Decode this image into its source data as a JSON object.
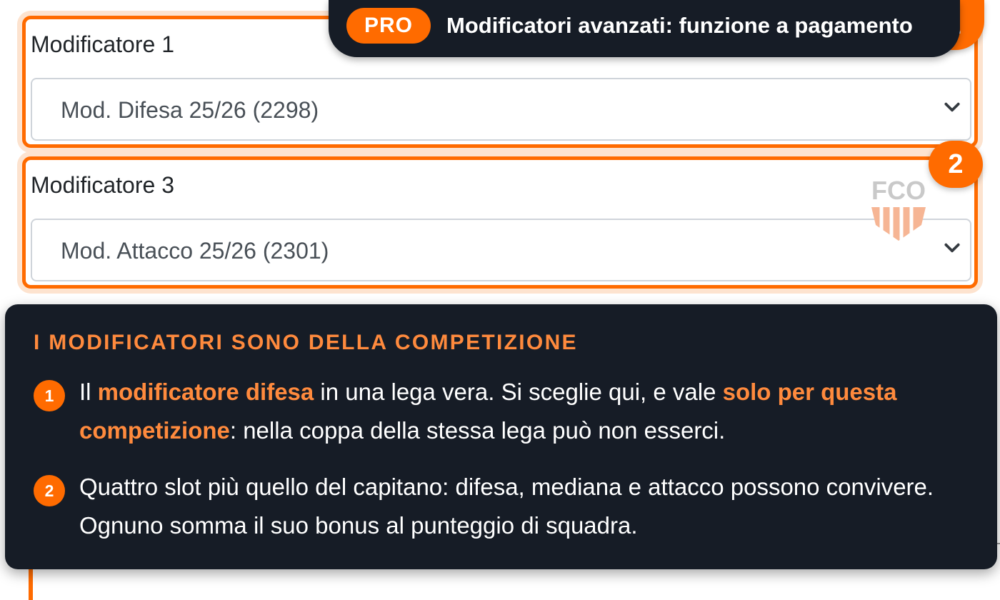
{
  "pro_banner": {
    "badge": "PRO",
    "text": "Modificatori avanzati: funzione a pagamento"
  },
  "fields": [
    {
      "label": "Modificatore 1",
      "selected": "Mod. Difesa 25/26 (2298)"
    },
    {
      "label": "Modificatore 3",
      "selected": "Mod. Attacco 25/26 (2301)"
    }
  ],
  "step_badges": [
    "1",
    "2"
  ],
  "watermark": {
    "text": "FCO"
  },
  "info": {
    "title": "I MODIFICATORI SONO DELLA COMPETIZIONE",
    "items": [
      {
        "num": "1",
        "p1": "Il ",
        "h1": "modificatore difesa",
        "p2": " in una lega vera. Si sceglie qui, e vale ",
        "h2": "solo per questa competizione",
        "p3": ": nella coppa della stessa lega può non esserci."
      },
      {
        "num": "2",
        "text": "Quattro slot più quello del capitano: difesa, mediana e attacco possono convivere. Ognuno somma il suo bonus al punteggio di squadra."
      }
    ]
  },
  "colors": {
    "accent": "#ff6b00",
    "accent_text": "#ff8a3d",
    "dark_panel": "#161c26"
  }
}
